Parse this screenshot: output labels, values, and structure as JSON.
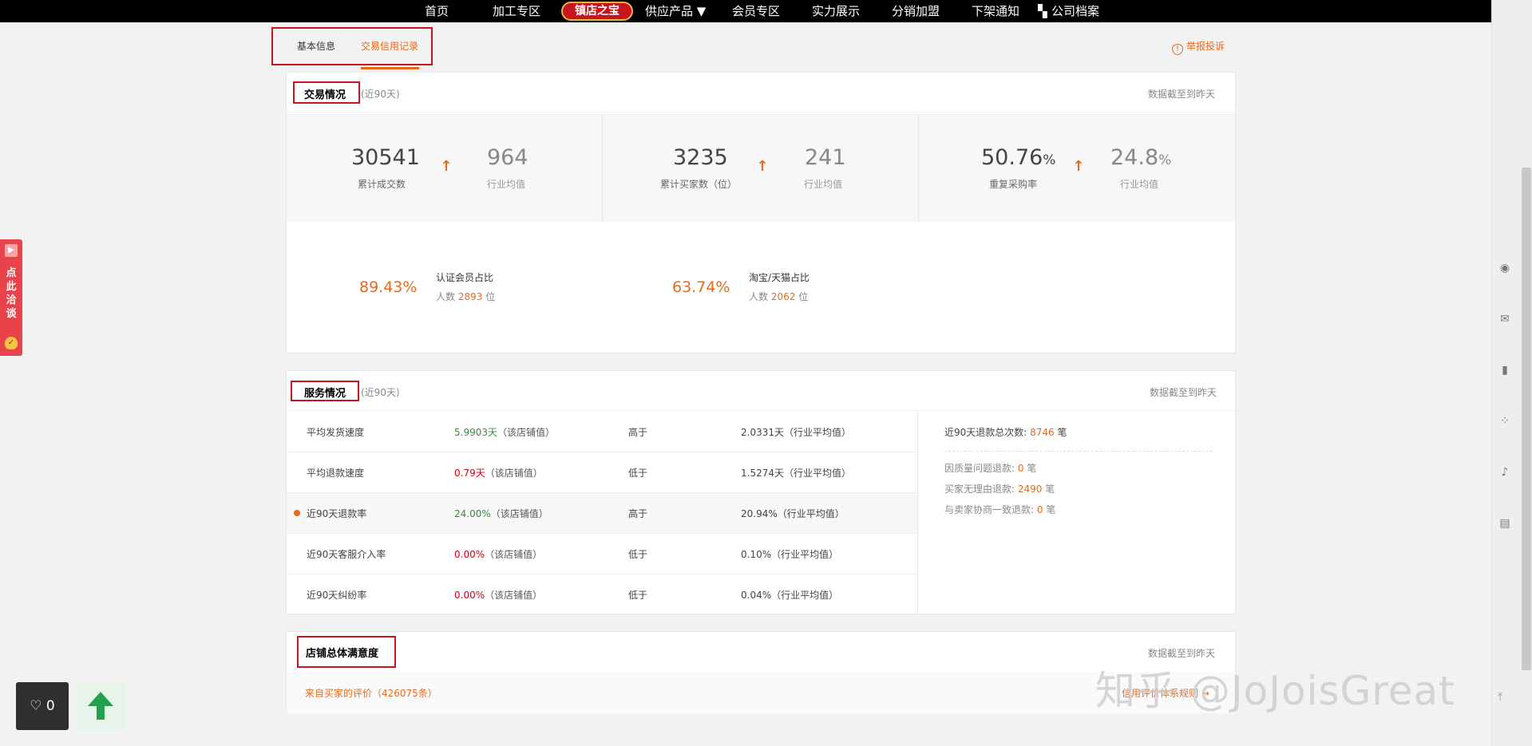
{
  "nav": {
    "items": [
      "首页",
      "加工专区",
      "供应产品 ▼",
      "会员专区",
      "实力展示",
      "分销加盟",
      "下架通知",
      "公司档案"
    ],
    "brand": "镇店之宝"
  },
  "chat_tab": {
    "text": "点此洽谈"
  },
  "tabs": {
    "basic": "基本信息",
    "credit": "交易信用记录"
  },
  "report": "举报投诉",
  "transaction": {
    "title": "交易情况",
    "sub": "(近90天)",
    "date_note": "数据截至到昨天",
    "stats": [
      {
        "value": "30541",
        "label": "累计成交数",
        "avg": "964",
        "avg_label": "行业均值"
      },
      {
        "value": "3235",
        "label": "累计买家数（位）",
        "avg": "241",
        "avg_label": "行业均值"
      },
      {
        "value": "50.76",
        "unit": "%",
        "label": "重复采购率",
        "avg": "24.8",
        "avg_unit": "%",
        "avg_label": "行业均值"
      }
    ],
    "ratios": [
      {
        "pct": "89.43%",
        "name": "认证会员占比",
        "count_prefix": "人数",
        "count": "2893",
        "count_suffix": "位"
      },
      {
        "pct": "63.74%",
        "name": "淘宝/天猫占比",
        "count_prefix": "人数",
        "count": "2062",
        "count_suffix": "位"
      }
    ]
  },
  "service": {
    "title": "服务情况",
    "sub": "(近90天)",
    "date_note": "数据截至到昨天",
    "rows": [
      {
        "name": "平均发货速度",
        "value": "5.9903天",
        "value_note": "（该店铺值）",
        "compare": "高于",
        "industry": "2.0331天（行业平均值）",
        "color": "green"
      },
      {
        "name": "平均退款速度",
        "value": "0.79天",
        "value_note": "（该店铺值）",
        "compare": "低于",
        "industry": "1.5274天（行业平均值）",
        "color": "red"
      },
      {
        "name": "近90天退款率",
        "value": "24.00%",
        "value_note": "（该店铺值）",
        "compare": "高于",
        "industry": "20.94%（行业平均值）",
        "color": "green"
      },
      {
        "name": "近90天客服介入率",
        "value": "0.00%",
        "value_note": "（该店铺值）",
        "compare": "低于",
        "industry": "0.10%（行业平均值）",
        "color": "red"
      },
      {
        "name": "近90天纠纷率",
        "value": "0.00%",
        "value_note": "（该店铺值）",
        "compare": "低于",
        "industry": "0.04%（行业平均值）",
        "color": "red"
      }
    ],
    "refund_total_label": "近90天退款总次数:",
    "refund_total": "8746",
    "refund_unit": "笔",
    "refund_breakdown": [
      {
        "label": "因质量问题退款:",
        "value": "0",
        "unit": "笔"
      },
      {
        "label": "买家无理由退款:",
        "value": "2490",
        "unit": "笔"
      },
      {
        "label": "与卖家协商一致退款:",
        "value": "0",
        "unit": "笔"
      }
    ]
  },
  "satisfaction": {
    "title": "店铺总体满意度",
    "date_note": "数据截至到昨天",
    "reviews_link": "来自买家的评价（426075条）",
    "rules_link": "信用评价体系规则 →"
  },
  "like": {
    "count": "0"
  },
  "watermark": "知乎 @JoJoisGreat",
  "colors": {
    "accent": "#e9691c",
    "highlight_box": "#c4161c",
    "up_arrow": "#e9691c"
  }
}
